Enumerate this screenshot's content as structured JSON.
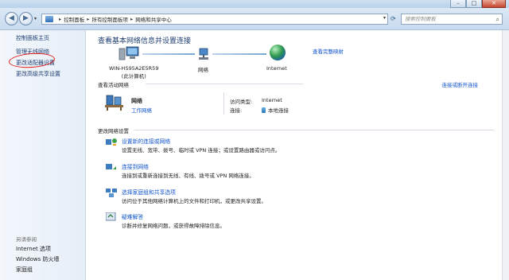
{
  "window": {
    "controls": {
      "minimize": "–",
      "maximize": "□",
      "close": "✕"
    }
  },
  "nav": {
    "back": "◀",
    "forward": "▶",
    "breadcrumb": [
      "控制面板",
      "所有控制面板项",
      "网络和共享中心"
    ],
    "search_placeholder": "搜索控制面板"
  },
  "sidebar": {
    "links": [
      "控制面板主页",
      "管理无线网络",
      "更改适配器设置",
      "更改高级共享设置"
    ],
    "see_also_heading": "另请参阅",
    "see_also": [
      "Internet 选项",
      "Windows 防火墙",
      "家庭组"
    ]
  },
  "main": {
    "title": "查看基本网络信息并设置连接",
    "full_map": "查看完整映射",
    "nodes": [
      {
        "label_line1": "WIN-HS95A2E5R59",
        "label_line2": "(此计算机)"
      },
      {
        "label_line1": "网络"
      },
      {
        "label_line1": "Internet"
      }
    ],
    "active_heading": "查看活动网络",
    "connect_link": "连接或断开连接",
    "network": {
      "name": "网络",
      "type": "工作网络",
      "access_type_label": "访问类型:",
      "access_type_value": "Internet",
      "connection_label": "连接:",
      "connection_value": "本地连接"
    },
    "change_heading": "更改网络设置",
    "tasks": [
      {
        "title": "设置新的连接或网络",
        "desc": "设置无线、宽带、拨号、临时或 VPN 连接；或设置路由器或访问点。"
      },
      {
        "title": "连接到网络",
        "desc": "连接到或重新连接到无线、有线、拨号或 VPN 网络连接。"
      },
      {
        "title": "选择家庭组和共享选项",
        "desc": "访问位于其他网络计算机上的文件和打印机，或更改共享设置。"
      },
      {
        "title": "疑难解答",
        "desc": "诊断并修复网络问题，或获得故障排除信息。"
      }
    ]
  },
  "colors": {
    "link": "#1155cc",
    "annotation_circle": "#e21a1a"
  }
}
